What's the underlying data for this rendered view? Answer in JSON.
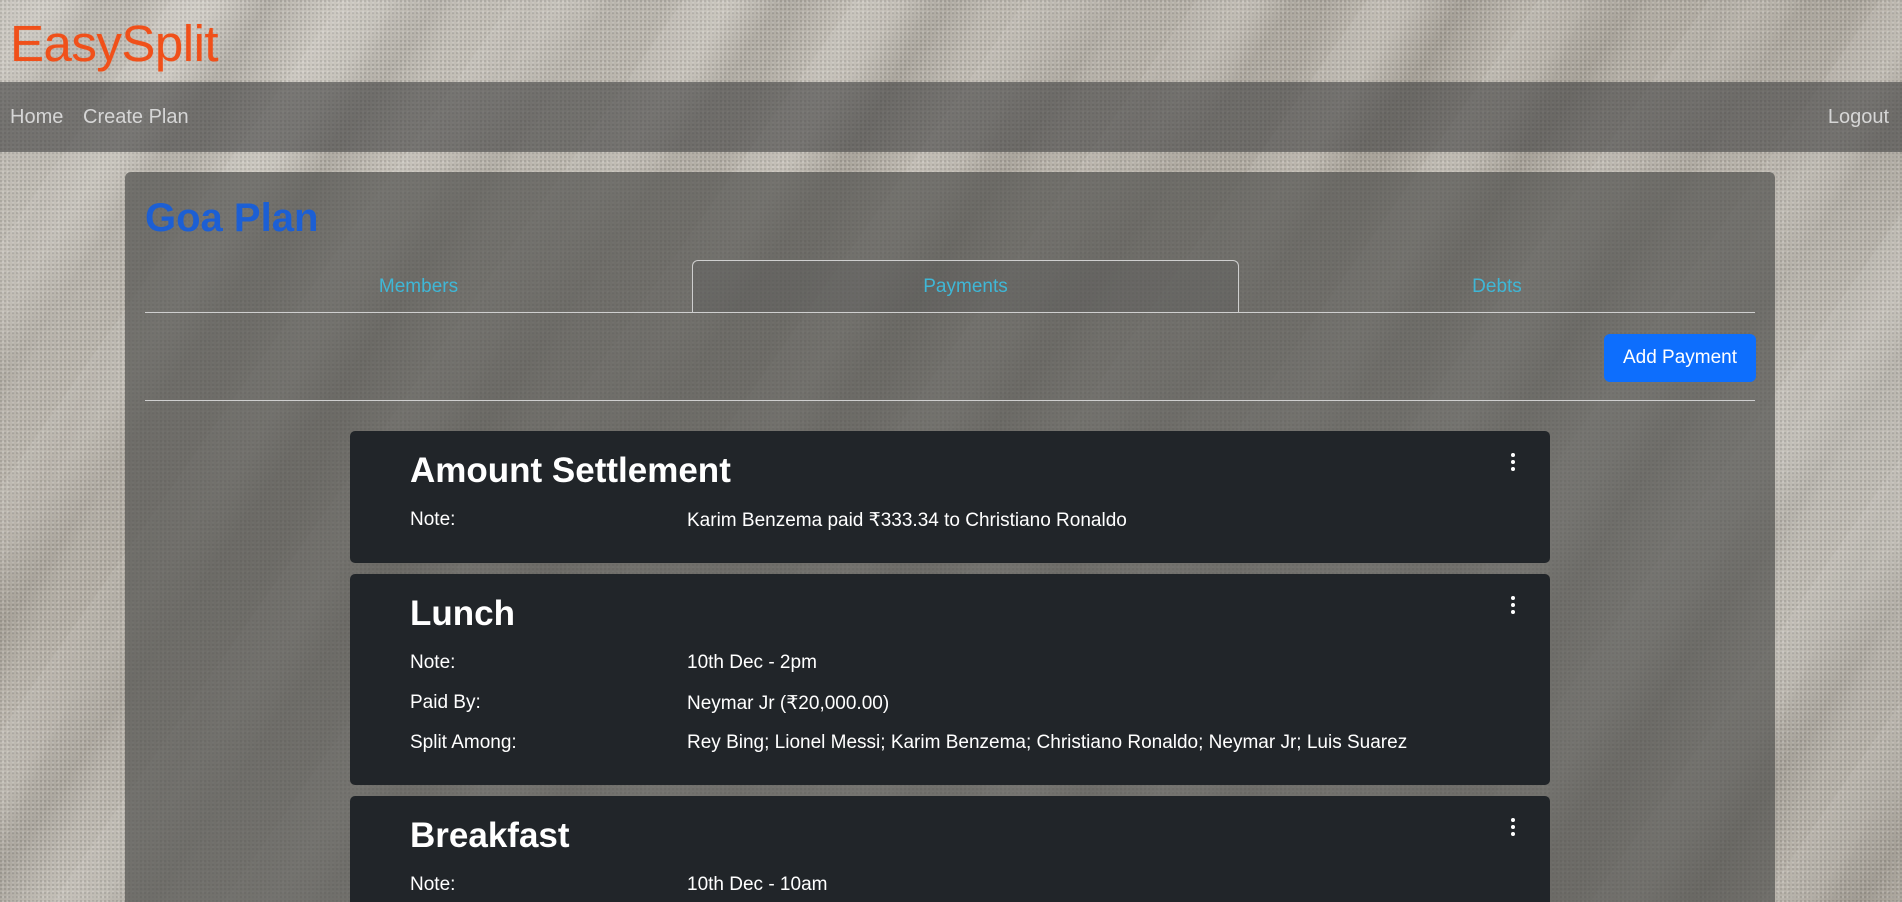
{
  "app": {
    "brand": "EasySplit"
  },
  "nav": {
    "home": "Home",
    "create_plan": "Create Plan",
    "logout": "Logout"
  },
  "plan": {
    "title": "Goa Plan",
    "tabs": [
      {
        "label": "Members",
        "active": false
      },
      {
        "label": "Payments",
        "active": true
      },
      {
        "label": "Debts",
        "active": false
      }
    ],
    "add_payment_label": "Add Payment"
  },
  "payments": [
    {
      "title": "Amount Settlement",
      "rows": [
        {
          "label": "Note:",
          "value": "Karim Benzema paid ₹333.34 to Christiano Ronaldo"
        }
      ]
    },
    {
      "title": "Lunch",
      "rows": [
        {
          "label": "Note:",
          "value": "10th Dec - 2pm"
        },
        {
          "label": "Paid By:",
          "value": "Neymar Jr (₹20,000.00)"
        },
        {
          "label": "Split Among:",
          "value": "Rey Bing; Lionel Messi; Karim Benzema; Christiano Ronaldo; Neymar Jr; Luis Suarez"
        }
      ]
    },
    {
      "title": "Breakfast",
      "rows": [
        {
          "label": "Note:",
          "value": "10th Dec - 10am"
        }
      ]
    }
  ],
  "colors": {
    "brand": "#f0501a",
    "plan_title": "#1c5fd4",
    "tab_text": "#3fb7d6",
    "primary_button": "#0d6efd",
    "card_bg": "#212529"
  }
}
